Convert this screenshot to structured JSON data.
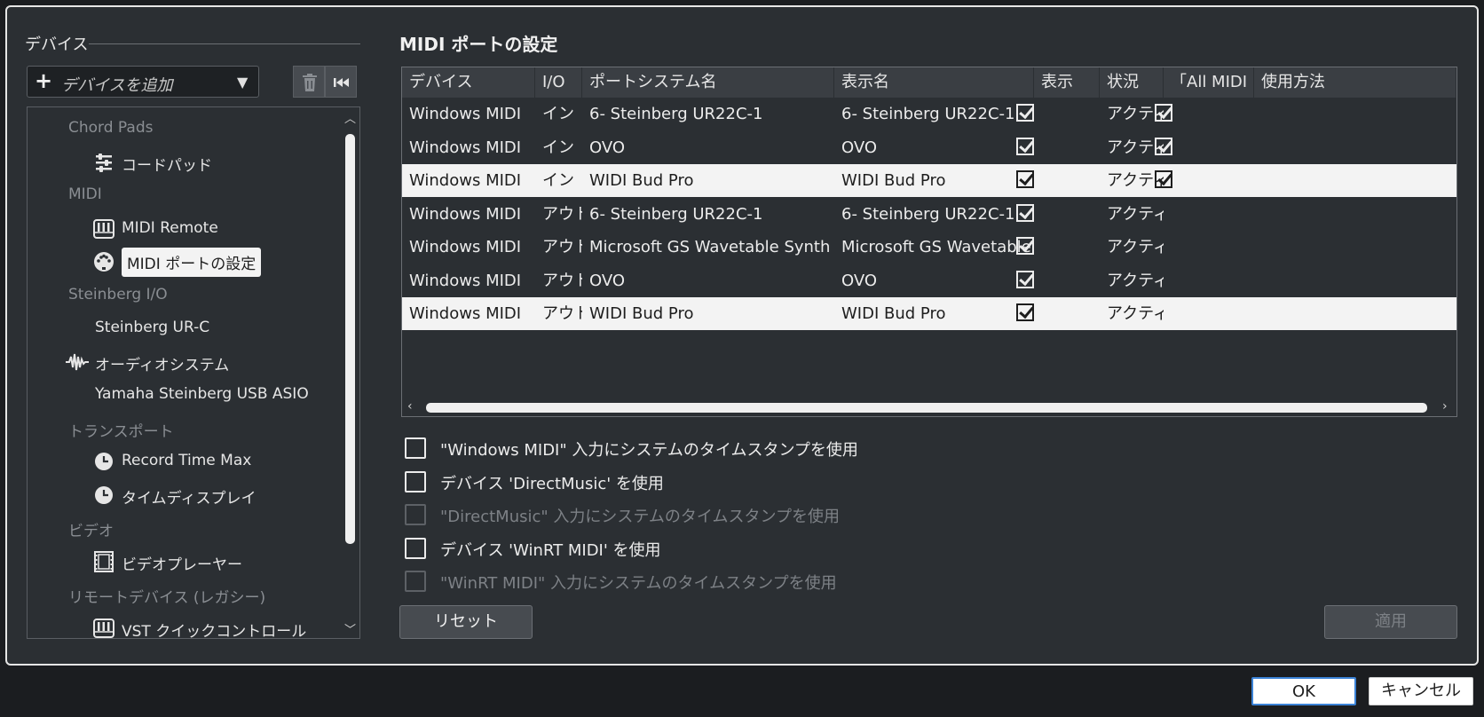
{
  "devices": {
    "title": "デバイス",
    "add_button": {
      "icon": "plus-icon",
      "label": "デバイスを追加",
      "arrow": "▼"
    },
    "tools": {
      "delete": "trash-icon",
      "reset": "skip-back-icon"
    },
    "tree": [
      {
        "type": "category",
        "label": "Chord Pads"
      },
      {
        "type": "item",
        "label": "コードパッド",
        "icon": "sliders-icon"
      },
      {
        "type": "category",
        "label": "MIDI"
      },
      {
        "type": "item",
        "label": "MIDI Remote",
        "icon": "keyboard-icon"
      },
      {
        "type": "item",
        "label": "MIDI ポートの設定",
        "icon": "midi-port-icon",
        "selected": true
      },
      {
        "type": "category",
        "label": "Steinberg I/O"
      },
      {
        "type": "plain",
        "label": "Steinberg UR-C"
      },
      {
        "type": "audio",
        "label": "オーディオシステム",
        "icon": "waveform-icon"
      },
      {
        "type": "plain",
        "label": "Yamaha Steinberg USB ASIO"
      },
      {
        "type": "category",
        "label": "トランスポート"
      },
      {
        "type": "item",
        "label": "Record Time Max",
        "icon": "clock-icon"
      },
      {
        "type": "item",
        "label": "タイムディスプレイ",
        "icon": "clock-icon"
      },
      {
        "type": "category",
        "label": "ビデオ"
      },
      {
        "type": "item",
        "label": "ビデオプレーヤー",
        "icon": "film-icon"
      },
      {
        "type": "category",
        "label": "リモートデバイス (レガシー)"
      },
      {
        "type": "item",
        "label": "VST クイックコントロール",
        "icon": "keyboard-icon"
      }
    ]
  },
  "main": {
    "title": "MIDI ポートの設定",
    "columns": [
      "デバイス",
      "I/O",
      "ポートシステム名",
      "表示名",
      "表示",
      "状況",
      "「All MIDI I",
      "使用方法"
    ],
    "rows": [
      {
        "device": "Windows MIDI",
        "io": "イン",
        "port": "6- Steinberg UR22C-1",
        "display": "6- Steinberg UR22C-1",
        "visible": true,
        "status": "アクティブ",
        "all_midi": true,
        "highlight": false
      },
      {
        "device": "Windows MIDI",
        "io": "イン",
        "port": "OVO",
        "display": "OVO",
        "visible": true,
        "status": "アクティブ",
        "all_midi": true,
        "highlight": false
      },
      {
        "device": "Windows MIDI",
        "io": "イン",
        "port": "WIDI Bud Pro",
        "display": "WIDI Bud Pro",
        "visible": true,
        "status": "アクティブ",
        "all_midi": true,
        "highlight": true
      },
      {
        "device": "Windows MIDI",
        "io": "アウト",
        "port": "6- Steinberg UR22C-1",
        "display": "6- Steinberg UR22C-1",
        "visible": true,
        "status": "アクティブ",
        "all_midi": false,
        "highlight": false
      },
      {
        "device": "Windows MIDI",
        "io": "アウト",
        "port": "Microsoft GS Wavetable Synth",
        "display": "Microsoft GS Wavetable Synth",
        "visible": true,
        "status": "アクティブ",
        "all_midi": false,
        "highlight": false
      },
      {
        "device": "Windows MIDI",
        "io": "アウト",
        "port": "OVO",
        "display": "OVO",
        "visible": true,
        "status": "アクティブ",
        "all_midi": false,
        "highlight": false
      },
      {
        "device": "Windows MIDI",
        "io": "アウト",
        "port": "WIDI Bud Pro",
        "display": "WIDI Bud Pro",
        "visible": true,
        "status": "アクティブ",
        "all_midi": false,
        "highlight": true
      }
    ],
    "options": [
      {
        "label": "\"Windows MIDI\" 入力にシステムのタイムスタンプを使用",
        "checked": false,
        "enabled": true
      },
      {
        "label": "デバイス 'DirectMusic' を使用",
        "checked": false,
        "enabled": true
      },
      {
        "label": "\"DirectMusic\" 入力にシステムのタイムスタンプを使用",
        "checked": false,
        "enabled": false
      },
      {
        "label": "デバイス 'WinRT MIDI' を使用",
        "checked": false,
        "enabled": true
      },
      {
        "label": "\"WinRT MIDI\" 入力にシステムのタイムスタンプを使用",
        "checked": false,
        "enabled": false
      }
    ],
    "reset_label": "リセット",
    "apply_label": "適用"
  },
  "footer": {
    "ok_label": "OK",
    "cancel_label": "キャンセル"
  }
}
